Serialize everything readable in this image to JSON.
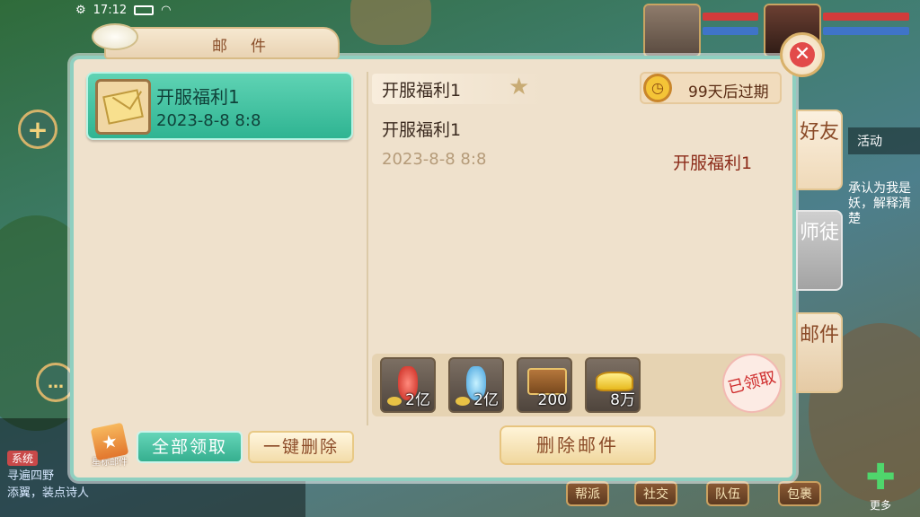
{
  "status_bar": {
    "time": "17:12"
  },
  "panel": {
    "title": "邮件",
    "close_label": "✕"
  },
  "mail_list": [
    {
      "title": "开服福利1",
      "date": "2023-8-8 8:8"
    }
  ],
  "left_actions": {
    "star_mail_label": "星标邮件",
    "claim_all_label": "全部领取",
    "delete_all_label": "一键删除"
  },
  "detail": {
    "header_title": "开服福利1",
    "expire_text": "99天后过期",
    "body_title": "开服福利1",
    "body_date": "2023-8-8 8:8",
    "sender": "开服福利1",
    "rewards": [
      {
        "icon": "red-potion-icon",
        "qty": "2亿"
      },
      {
        "icon": "blue-potion-icon",
        "qty": "2亿"
      },
      {
        "icon": "treasure-chest-icon",
        "qty": "200"
      },
      {
        "icon": "gold-ingot-icon",
        "qty": "8万"
      }
    ],
    "claimed_stamp": "已领取",
    "delete_label": "删除邮件"
  },
  "side_tabs": [
    "好友",
    "师徒",
    "邮件"
  ],
  "background": {
    "activity_label": "活动",
    "quest_text": "承认为我是妖，解释清楚",
    "chat_tag": "系统",
    "chat_line_1": "寻遍四野",
    "chat_line_2": "添翼，装点诗人",
    "nav_items": [
      "帮派",
      "社交",
      "队伍",
      "包裹"
    ],
    "more_label": "更多"
  },
  "colors": {
    "panel_bg": "#efe1cc",
    "panel_border": "#8fcfc0",
    "selected_item": "#36af8f",
    "sender_red": "#8b2a18",
    "claimed_red": "#cf2d2d"
  }
}
